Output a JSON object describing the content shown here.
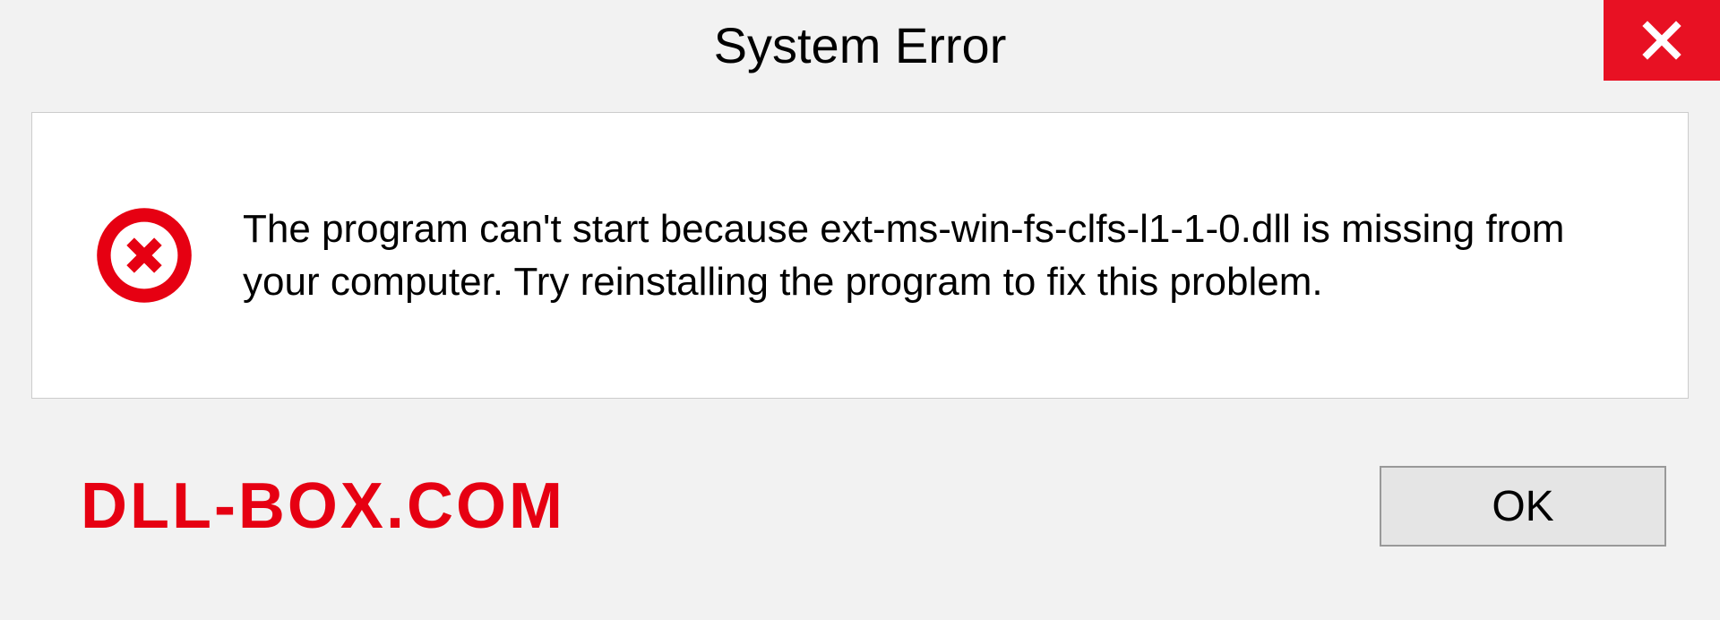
{
  "dialog": {
    "title": "System Error",
    "message": "The program can't start because ext-ms-win-fs-clfs-l1-1-0.dll is missing from your computer. Try reinstalling the program to fix this problem.",
    "ok_label": "OK"
  },
  "watermark": "DLL-BOX.COM",
  "colors": {
    "accent_red": "#e81123",
    "watermark_red": "#e60012",
    "background": "#f2f2f2",
    "button_bg": "#e5e5e5"
  }
}
